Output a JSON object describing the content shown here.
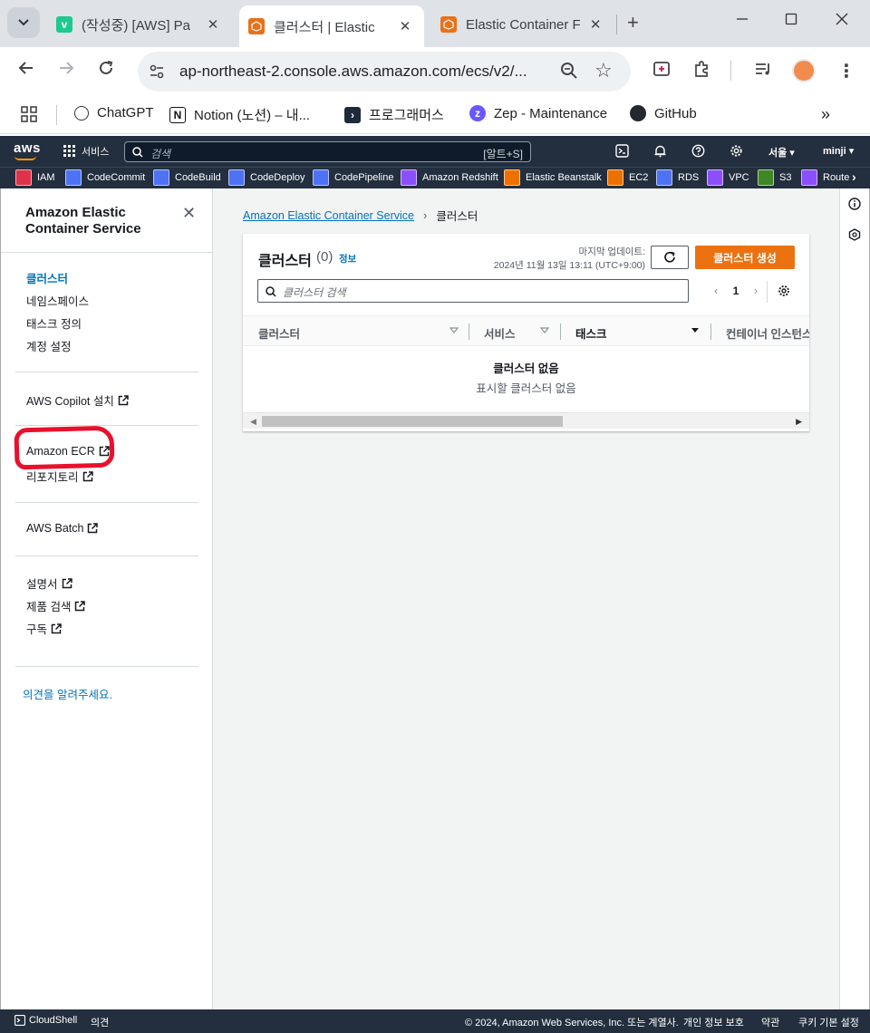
{
  "browser": {
    "tabs": [
      {
        "title": "(작성중) [AWS] Pa",
        "favicon_color": "#1ec98c",
        "favicon_letter": "v"
      },
      {
        "title": "클러스터 | Elastic",
        "favicon_color": "#e8711a"
      },
      {
        "title": "Elastic Container F",
        "favicon_color": "#e8711a"
      }
    ],
    "url": "ap-northeast-2.console.aws.amazon.com/ecs/v2/...",
    "bookmarks": [
      {
        "label": "ChatGPT",
        "icon": "chatgpt-icon"
      },
      {
        "label": "Notion (노션) – 내...",
        "icon": "notion-icon"
      },
      {
        "label": "프로그래머스",
        "icon": "programmers-icon"
      },
      {
        "label": "Zep - Maintenance",
        "icon": "zep-icon"
      },
      {
        "label": "GitHub",
        "icon": "github-icon"
      }
    ]
  },
  "aws_header": {
    "logo": "aws",
    "services_label": "서비스",
    "search_placeholder": "검색",
    "search_shortcut": "[알트+S]",
    "region": "서울 ▾",
    "user": "minji ▾"
  },
  "favorites": [
    {
      "label": "IAM",
      "color": "#dd344c"
    },
    {
      "label": "CodeCommit",
      "color": "#4d72f3"
    },
    {
      "label": "CodeBuild",
      "color": "#4d72f3"
    },
    {
      "label": "CodeDeploy",
      "color": "#4d72f3"
    },
    {
      "label": "CodePipeline",
      "color": "#4d72f3"
    },
    {
      "label": "Amazon Redshift",
      "color": "#8c4fff"
    },
    {
      "label": "Elastic Beanstalk",
      "color": "#ed7100"
    },
    {
      "label": "EC2",
      "color": "#ed7100"
    },
    {
      "label": "RDS",
      "color": "#4d72f3"
    },
    {
      "label": "VPC",
      "color": "#8c4fff"
    },
    {
      "label": "S3",
      "color": "#3f8624"
    },
    {
      "label": "Route",
      "color": "#8c4fff"
    }
  ],
  "sidebar": {
    "title": "Amazon Elastic Container Service",
    "items": [
      {
        "label": "클러스터",
        "active": true
      },
      {
        "label": "네임스페이스"
      },
      {
        "label": "태스크 정의"
      },
      {
        "label": "계정 설정"
      }
    ],
    "copilot": "AWS Copilot 설치",
    "ecr": "Amazon ECR",
    "repositories": "리포지토리",
    "batch": "AWS Batch",
    "docs": "설명서",
    "product_search": "제품 검색",
    "subscribe": "구독",
    "feedback": "의견을 알려주세요."
  },
  "breadcrumb": {
    "root": "Amazon Elastic Container Service",
    "current": "클러스터"
  },
  "clusters_panel": {
    "title": "클러스터",
    "count": "(0)",
    "info": "정보",
    "last_updated_label": "마지막 업데이트:",
    "last_updated_value": "2024년 11월 13일 13:11 (UTC+9:00)",
    "create_button": "클러스터 생성",
    "search_placeholder": "클러스터 검색",
    "page": "1",
    "columns": [
      "클러스터",
      "서비스",
      "태스크",
      "컨테이너 인스턴스"
    ],
    "sorted_column": "태스크",
    "empty_title": "클러스터 없음",
    "empty_desc": "표시할 클러스터 없음"
  },
  "footer": {
    "cloudshell": "CloudShell",
    "feedback": "의견",
    "copyright": "© 2024, Amazon Web Services, Inc. 또는 계열사.",
    "privacy": "개인 정보 보호",
    "terms": "약관",
    "cookies": "쿠키 기본 설정"
  }
}
